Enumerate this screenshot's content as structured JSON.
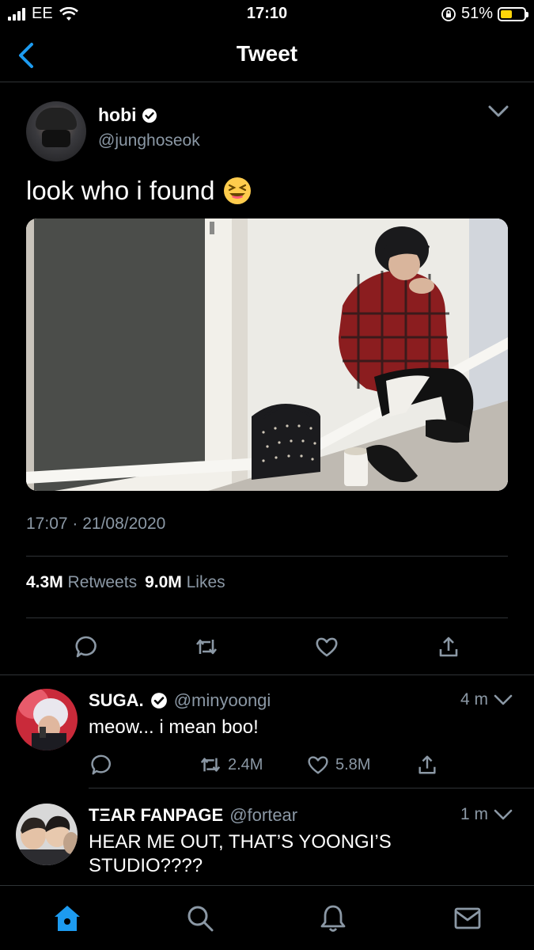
{
  "status_bar": {
    "carrier": "EE",
    "time": "17:10",
    "battery": "51%",
    "battery_level": 0.51
  },
  "nav": {
    "title": "Tweet"
  },
  "tweet": {
    "author_name": "hobi",
    "author_handle": "@junghoseok",
    "text": "look who i found",
    "timestamp": "17:07 · 21/08/2020",
    "retweets_count": "4.3M",
    "retweets_label": "Retweets",
    "likes_count": "9.0M",
    "likes_label": "Likes"
  },
  "replies": [
    {
      "name": "SUGA.",
      "handle": "@minyoongi",
      "time": "4 m",
      "text": "meow... i mean boo!",
      "retweets": "2.4M",
      "likes": "5.8M"
    },
    {
      "name": "TΞAR FANPAGE",
      "handle": "@fortear",
      "time": "1 m",
      "text": "HEAR ME OUT, THAT’S YOONGI’S STUDIO????"
    }
  ],
  "colors": {
    "accent": "#1d9bf0",
    "muted": "#8b98a5",
    "background": "#000000",
    "divider": "#2f3336"
  },
  "icons": {
    "back": "chevron-left-icon",
    "more": "chevron-down-icon",
    "reply": "reply-icon",
    "retweet": "retweet-icon",
    "like": "heart-icon",
    "share": "share-icon",
    "home": "home-icon",
    "search": "search-icon",
    "notifications": "bell-icon",
    "messages": "mail-icon"
  }
}
